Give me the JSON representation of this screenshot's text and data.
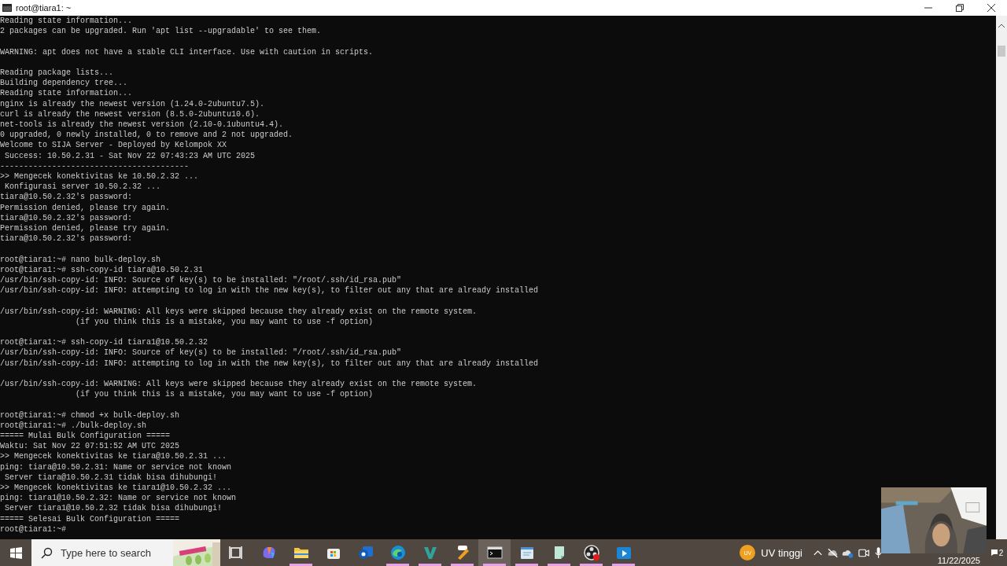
{
  "window": {
    "title": "root@tiara1: ~"
  },
  "terminal": {
    "blocks": [
      [
        "Reading state information...",
        "2 packages can be upgraded. Run 'apt list --upgradable' to see them."
      ],
      [
        "WARNING: apt does not have a stable CLI interface. Use with caution in scripts."
      ],
      [
        "Reading package lists...",
        "Building dependency tree...",
        "Reading state information...",
        "nginx is already the newest version (1.24.0-2ubuntu7.5).",
        "curl is already the newest version (8.5.0-2ubuntu10.6).",
        "net-tools is already the newest version (2.10-0.1ubuntu4.4).",
        "0 upgraded, 0 newly installed, 0 to remove and 2 not upgraded.",
        "Welcome to SIJA Server - Deployed by Kelompok XX",
        " Success: 10.50.2.31 - Sat Nov 22 07:43:23 AM UTC 2025",
        "----------------------------------------",
        ">> Mengecek konektivitas ke 10.50.2.32 ...",
        " Konfigurasi server 10.50.2.32 ...",
        "tiara@10.50.2.32's password:",
        "Permission denied, please try again.",
        "tiara@10.50.2.32's password:",
        "Permission denied, please try again.",
        "tiara@10.50.2.32's password:"
      ],
      [
        "root@tiara1:~# nano bulk-deploy.sh",
        "root@tiara1:~# ssh-copy-id tiara@10.50.2.31",
        "/usr/bin/ssh-copy-id: INFO: Source of key(s) to be installed: \"/root/.ssh/id_rsa.pub\"",
        "/usr/bin/ssh-copy-id: INFO: attempting to log in with the new key(s), to filter out any that are already installed"
      ],
      [
        "/usr/bin/ssh-copy-id: WARNING: All keys were skipped because they already exist on the remote system.",
        "                (if you think this is a mistake, you may want to use -f option)"
      ],
      [
        "root@tiara1:~# ssh-copy-id tiara1@10.50.2.32",
        "/usr/bin/ssh-copy-id: INFO: Source of key(s) to be installed: \"/root/.ssh/id_rsa.pub\"",
        "/usr/bin/ssh-copy-id: INFO: attempting to log in with the new key(s), to filter out any that are already installed"
      ],
      [
        "/usr/bin/ssh-copy-id: WARNING: All keys were skipped because they already exist on the remote system.",
        "                (if you think this is a mistake, you may want to use -f option)"
      ],
      [
        "root@tiara1:~# chmod +x bulk-deploy.sh",
        "root@tiara1:~# ./bulk-deploy.sh",
        "===== Mulai Bulk Configuration =====",
        "Waktu: Sat Nov 22 07:51:52 AM UTC 2025",
        ">> Mengecek konektivitas ke tiara@10.50.2.31 ...",
        "ping: tiara@10.50.2.31: Name or service not known",
        " Server tiara@10.50.2.31 tidak bisa dihubungi!",
        ">> Mengecek konektivitas ke tiara1@10.50.2.32 ...",
        "ping: tiara1@10.50.2.32: Name or service not known",
        " Server tiara1@10.50.2.32 tidak bisa dihubungi!",
        "===== Selesai Bulk Configuration =====",
        "root@tiara1:~#"
      ]
    ]
  },
  "taskbar": {
    "search": {
      "placeholder": "Type here to search"
    },
    "apps": [
      {
        "kind": "taskview",
        "running": false,
        "active": false
      },
      {
        "kind": "copilot",
        "running": false,
        "active": false
      },
      {
        "kind": "folder",
        "running": true,
        "active": false
      },
      {
        "kind": "store",
        "running": false,
        "active": false
      },
      {
        "kind": "mail",
        "running": false,
        "active": false
      },
      {
        "kind": "edge",
        "running": true,
        "active": false
      },
      {
        "kind": "code",
        "running": true,
        "active": false
      },
      {
        "kind": "tool",
        "running": true,
        "active": false
      },
      {
        "kind": "terminal",
        "running": true,
        "active": true
      },
      {
        "kind": "notepad",
        "running": true,
        "active": false
      },
      {
        "kind": "notes",
        "running": true,
        "active": false
      },
      {
        "kind": "recorder",
        "running": true,
        "active": false
      },
      {
        "kind": "player",
        "running": true,
        "active": false
      }
    ],
    "weather": {
      "badge": "UV",
      "label": "UV tinggi"
    },
    "date": "11/22/2025",
    "notifications": "2"
  }
}
